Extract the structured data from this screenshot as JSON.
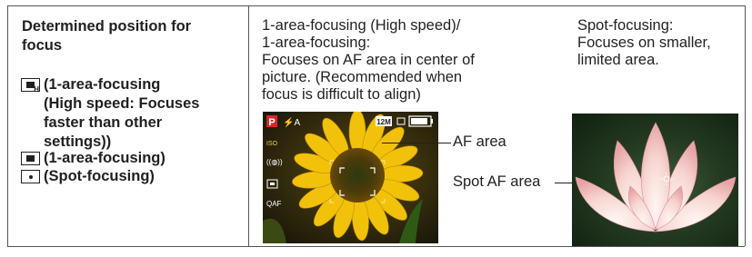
{
  "left": {
    "title_line1": "Determined position for",
    "title_line2": "focus",
    "modes": [
      {
        "icon": "1-area-focusing-high-speed-icon",
        "lines": [
          "(1-area-focusing",
          "(High speed: Focuses",
          "faster than other",
          "settings))"
        ]
      },
      {
        "icon": "1-area-focusing-icon",
        "lines": [
          "(1-area-focusing)"
        ]
      },
      {
        "icon": "spot-focusing-icon",
        "lines": [
          "(Spot-focusing)"
        ]
      }
    ]
  },
  "middle": {
    "lines": [
      "1-area-focusing (High speed)/",
      "1-area-focusing:",
      "Focuses on AF area in center of",
      "picture. (Recommended when",
      "focus is difficult to align)"
    ],
    "photo_overlay": {
      "p_mode": "P",
      "flash": "⚡A",
      "size": "12M",
      "q_af": "QAF",
      "ois": "((◍))"
    },
    "callout": "AF area"
  },
  "right": {
    "lines": [
      "Spot-focusing:",
      "Focuses on smaller,",
      "limited area."
    ],
    "callout": "Spot AF area"
  }
}
